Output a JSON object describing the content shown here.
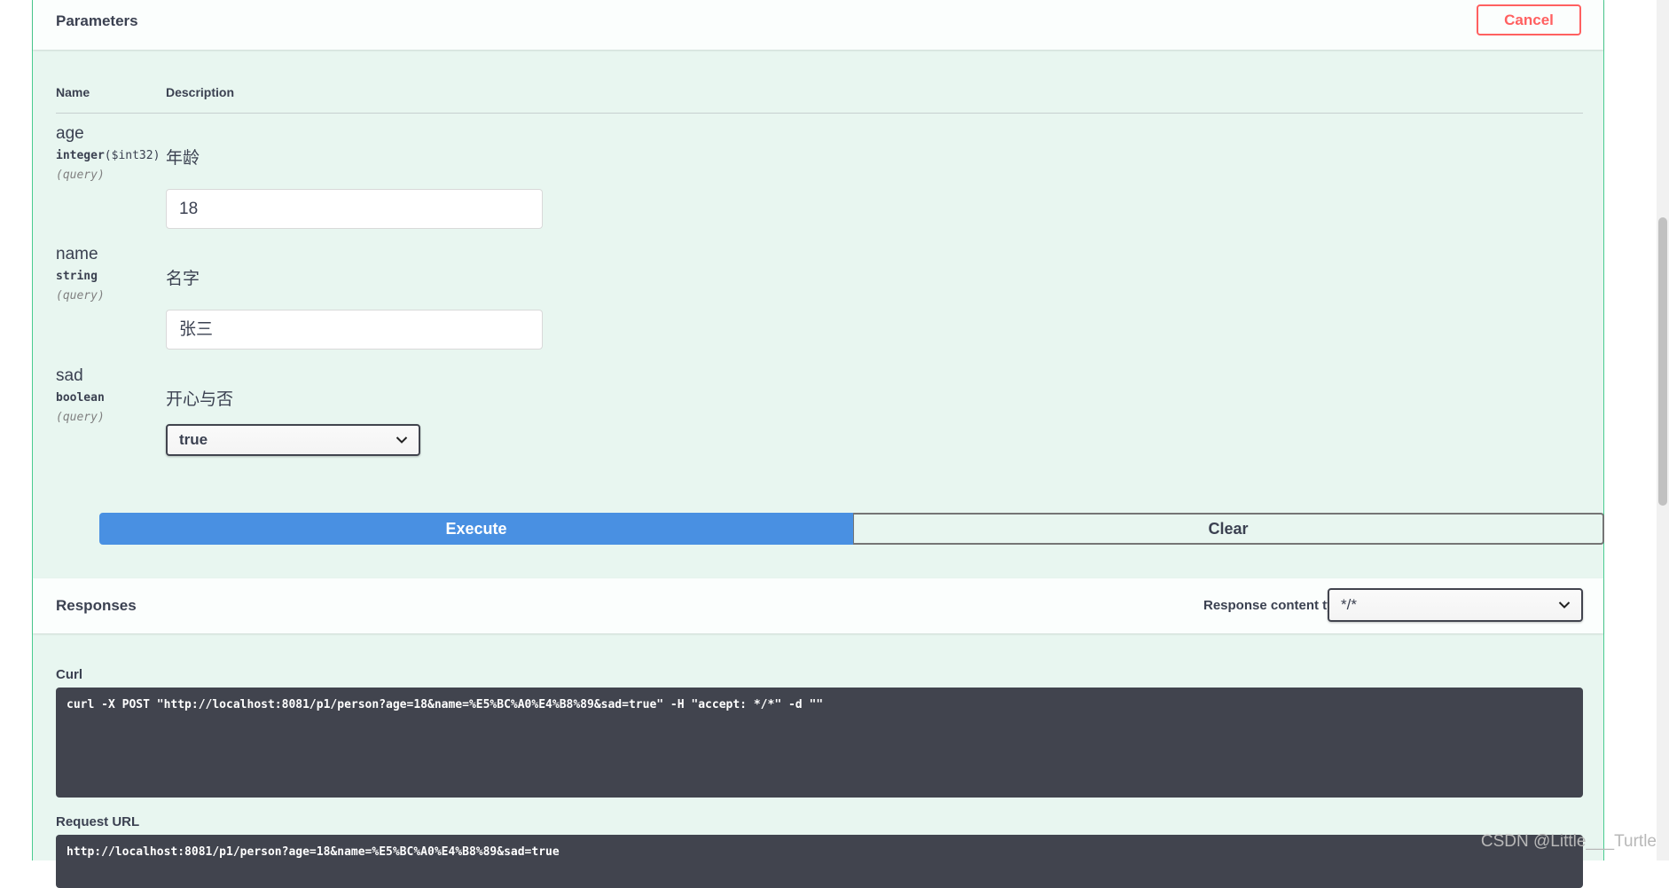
{
  "parameters_section": {
    "title": "Parameters",
    "cancel_label": "Cancel",
    "col_name": "Name",
    "col_description": "Description",
    "params": [
      {
        "name": "age",
        "type": "integer",
        "format": "($int32)",
        "in": "(query)",
        "description": "年龄",
        "value": "18"
      },
      {
        "name": "name",
        "type": "string",
        "in": "(query)",
        "description": "名字",
        "value": "张三"
      },
      {
        "name": "sad",
        "type": "boolean",
        "in": "(query)",
        "description": "开心与否",
        "selected": "true"
      }
    ],
    "execute_label": "Execute",
    "clear_label": "Clear"
  },
  "responses_section": {
    "title": "Responses",
    "content_type_label": "Response content type",
    "content_type_value": "*/*",
    "curl_label": "Curl",
    "curl_command": "curl -X POST \"http://localhost:8081/p1/person?age=18&name=%E5%BC%A0%E4%B8%89&sad=true\" -H \"accept: */*\" -d \"\"",
    "request_url_label": "Request URL",
    "request_url": "http://localhost:8081/p1/person?age=18&name=%E5%BC%A0%E4%B8%89&sad=true"
  },
  "watermark": "CSDN @Little___Turtle",
  "colors": {
    "post_accent": "#49cc90",
    "execute_blue": "#4990e2",
    "cancel_red": "#ff6060",
    "code_bg": "#41444e"
  }
}
